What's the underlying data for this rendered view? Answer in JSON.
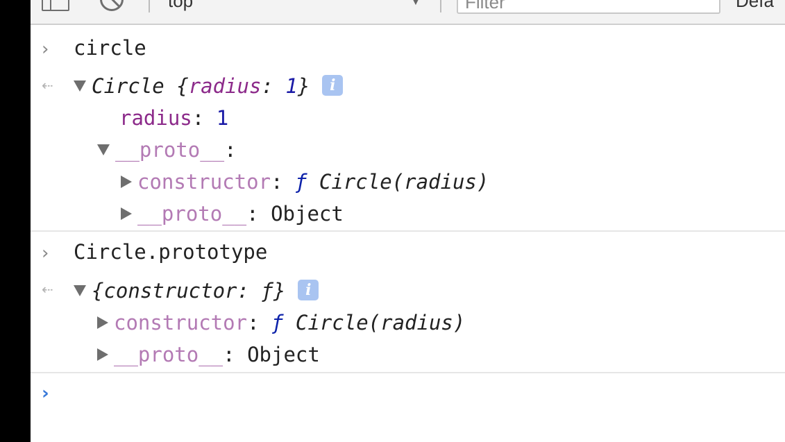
{
  "toolbar": {
    "context": "top",
    "filter_placeholder": "Filter",
    "levels_label": "Defa"
  },
  "messages": [
    {
      "input": "circle",
      "result": {
        "summary_class": "Circle",
        "summary_open": "{",
        "summary_key": "radius",
        "summary_colon": ": ",
        "summary_value": "1",
        "summary_close": "}",
        "info": "i",
        "props": [
          {
            "key": "radius",
            "colon": ": ",
            "value": "1"
          }
        ],
        "proto": {
          "key": "__proto__",
          "colon": ":",
          "children": [
            {
              "key": "constructor",
              "colon": ": ",
              "fn_keyword": "ƒ",
              "value": "Circle(radius)"
            },
            {
              "key": "__proto__",
              "colon": ": ",
              "value": "Object"
            }
          ]
        }
      }
    },
    {
      "input": "Circle.prototype",
      "result": {
        "summary": "{constructor: ƒ}",
        "info": "i",
        "children": [
          {
            "key": "constructor",
            "colon": ": ",
            "fn_keyword": "ƒ",
            "value": "Circle(radius)"
          },
          {
            "key": "__proto__",
            "colon": ": ",
            "value": "Object"
          }
        ]
      }
    }
  ],
  "icons": {
    "input_prompt": "chevron-right-icon",
    "result_arrow": "return-arrow-icon",
    "expand_open": "triangle-down-icon",
    "expand_closed": "triangle-right-icon",
    "info": "info-icon"
  },
  "colors": {
    "property": "#8c2a8a",
    "inherited_property": "#b37ab4",
    "number": "#1a1aa6",
    "prompt_caret": "#3879d9",
    "info_badge": "#a9c4f1"
  }
}
